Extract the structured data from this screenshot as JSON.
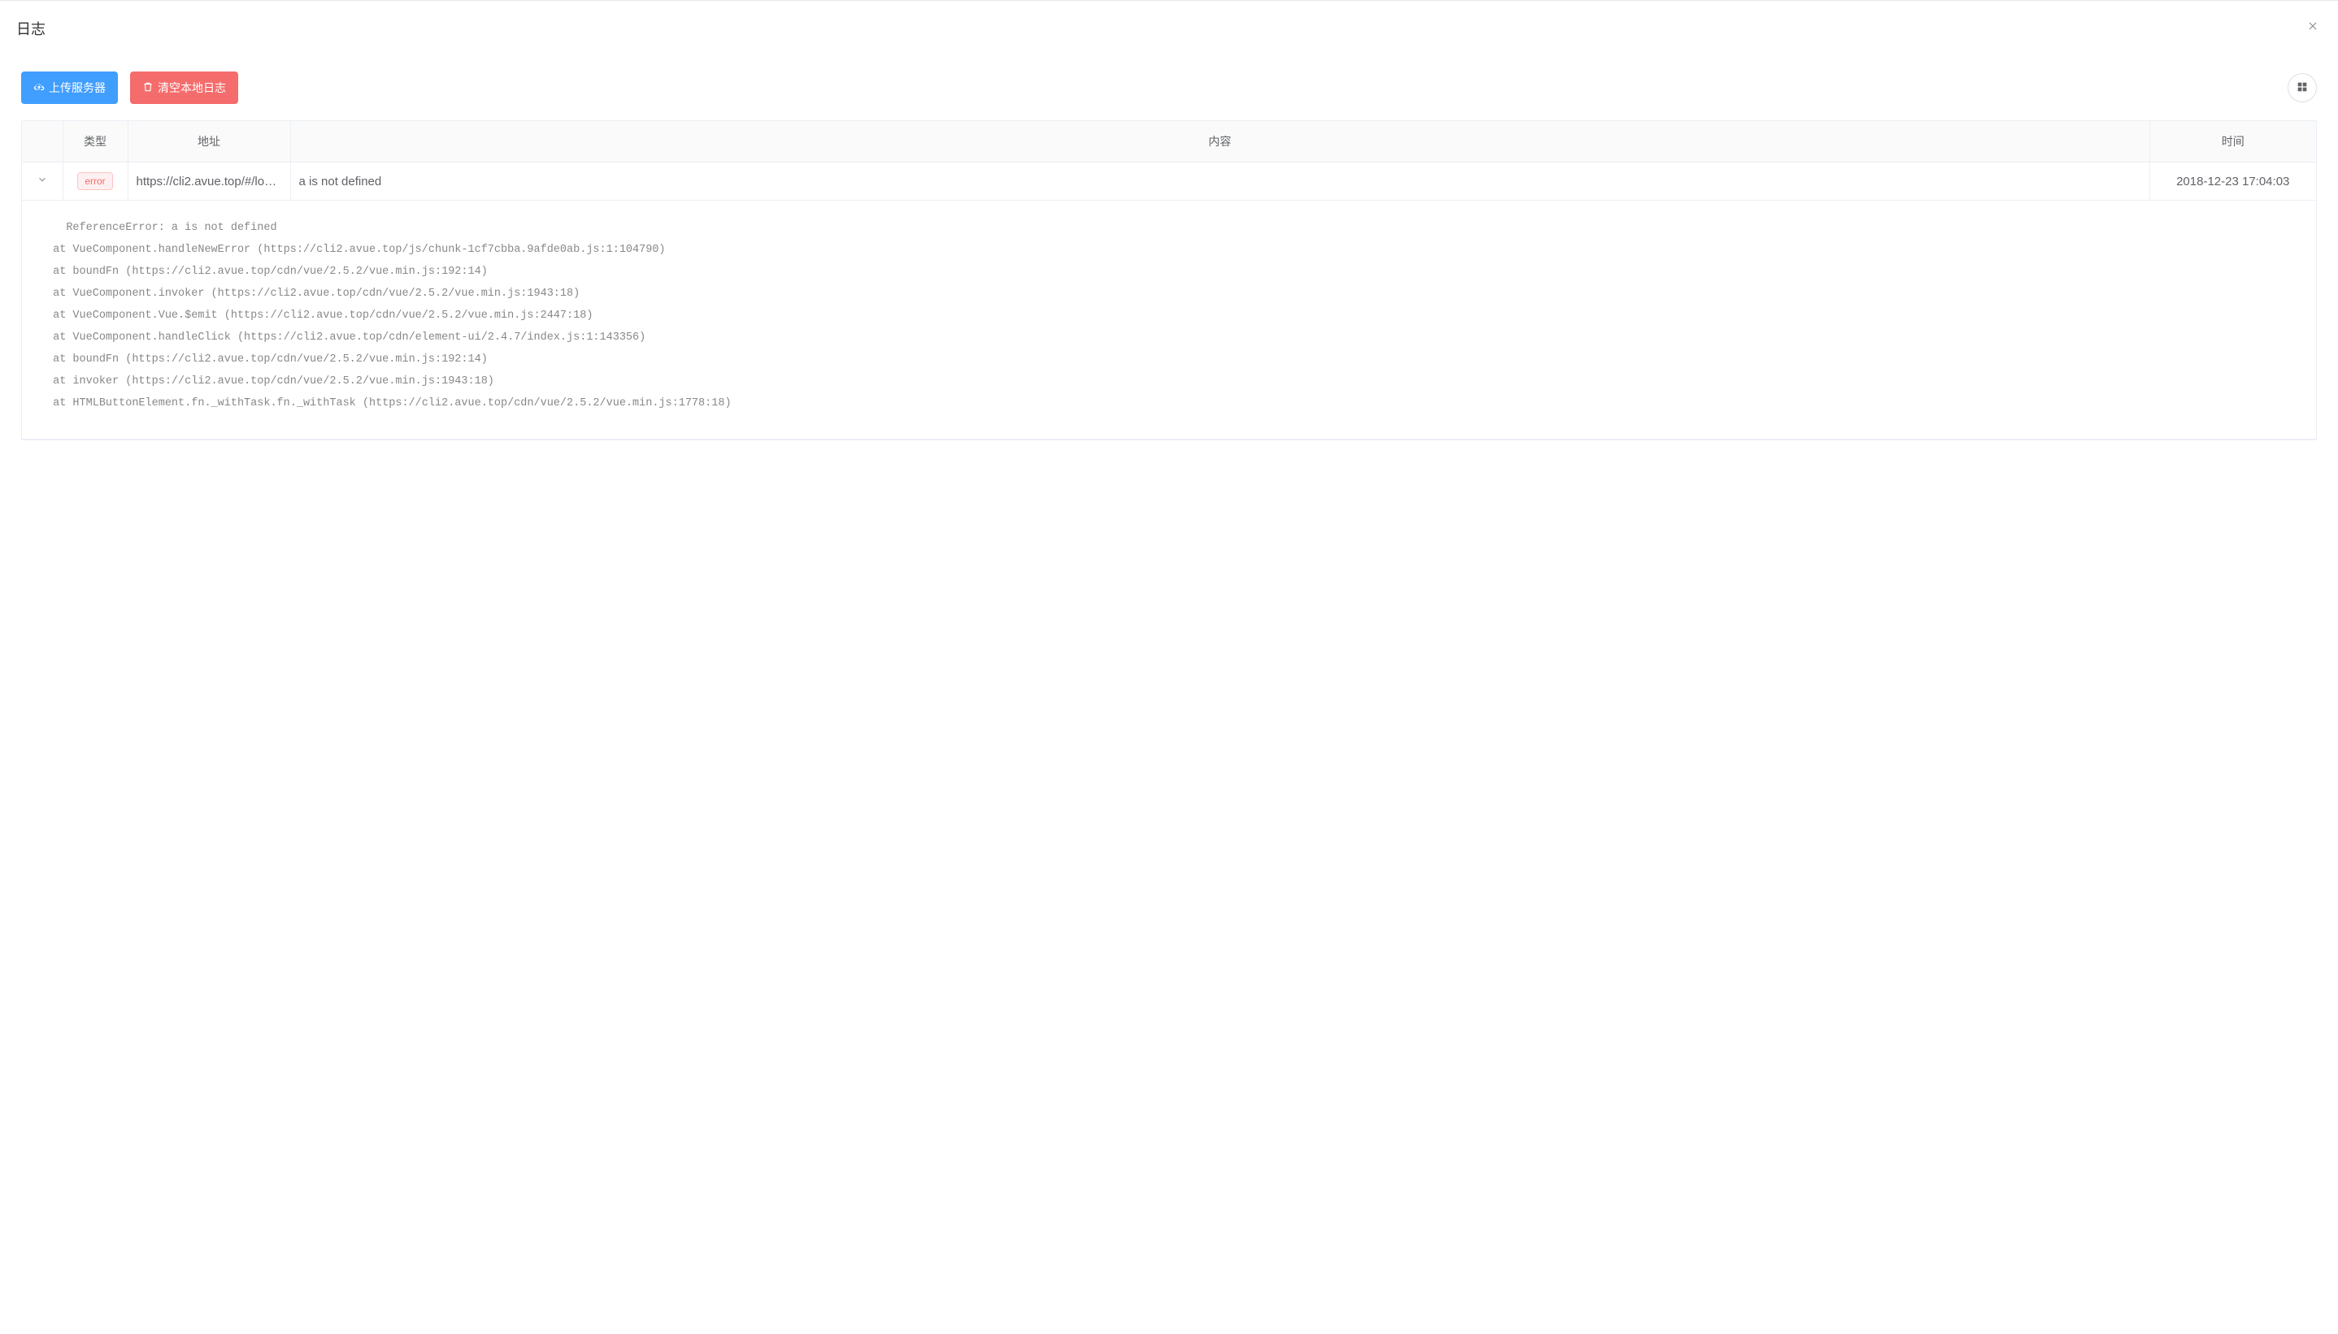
{
  "header": {
    "title": "日志"
  },
  "toolbar": {
    "upload_label": "上传服务器",
    "clear_label": "清空本地日志"
  },
  "table": {
    "headers": {
      "type": "类型",
      "url": "地址",
      "content": "内容",
      "time": "时间"
    },
    "rows": [
      {
        "type_label": "error",
        "url": "https://cli2.avue.top/#/log…",
        "content": "a is not defined",
        "time": "2018-12-23 17:04:03",
        "stack": "   ReferenceError: a is not defined\n at VueComponent.handleNewError (https://cli2.avue.top/js/chunk-1cf7cbba.9afde0ab.js:1:104790)\n at boundFn (https://cli2.avue.top/cdn/vue/2.5.2/vue.min.js:192:14)\n at VueComponent.invoker (https://cli2.avue.top/cdn/vue/2.5.2/vue.min.js:1943:18)\n at VueComponent.Vue.$emit (https://cli2.avue.top/cdn/vue/2.5.2/vue.min.js:2447:18)\n at VueComponent.handleClick (https://cli2.avue.top/cdn/element-ui/2.4.7/index.js:1:143356)\n at boundFn (https://cli2.avue.top/cdn/vue/2.5.2/vue.min.js:192:14)\n at invoker (https://cli2.avue.top/cdn/vue/2.5.2/vue.min.js:1943:18)\n at HTMLButtonElement.fn._withTask.fn._withTask (https://cli2.avue.top/cdn/vue/2.5.2/vue.min.js:1778:18)"
      }
    ]
  }
}
